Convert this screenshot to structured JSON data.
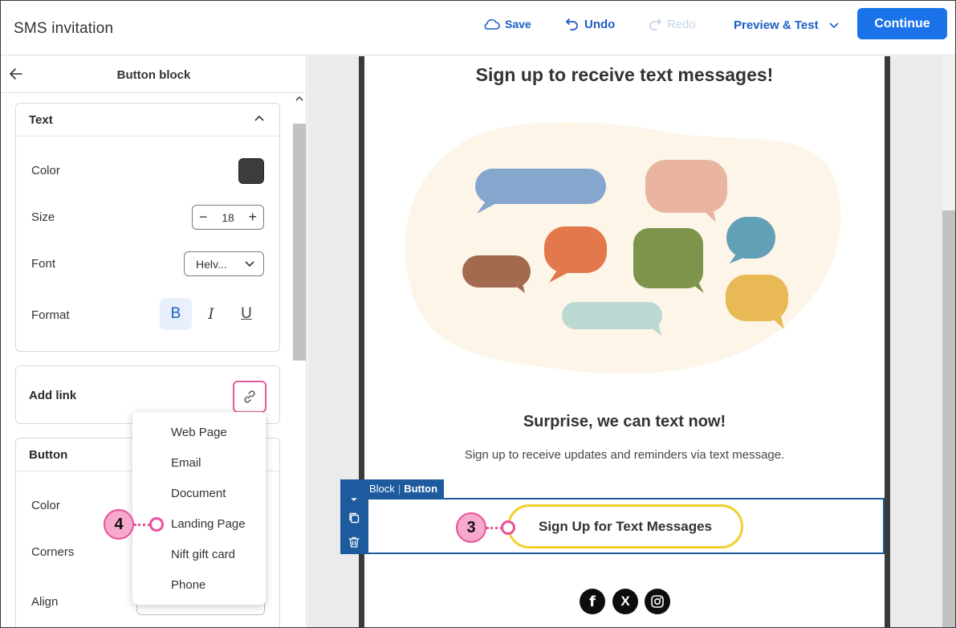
{
  "app": {
    "title": "SMS invitation"
  },
  "toolbar": {
    "save_label": "Save",
    "undo_label": "Undo",
    "redo_label": "Redo",
    "preview_label": "Preview & Test",
    "continue_label": "Continue"
  },
  "panel": {
    "title": "Button block",
    "text_section": {
      "title": "Text",
      "color_label": "Color",
      "color_value": "#3c3c3c",
      "size_label": "Size",
      "size_value": "18",
      "font_label": "Font",
      "font_value": "Helv...",
      "format_label": "Format",
      "format_bold": "B",
      "format_italic": "I",
      "format_underline": "U"
    },
    "link_section": {
      "title": "Add link"
    },
    "button_section": {
      "title": "Button",
      "color_label": "Color",
      "corners_label": "Corners",
      "align_label": "Align"
    },
    "link_menu": [
      "Web Page",
      "Email",
      "Document",
      "Landing Page",
      "Nift gift card",
      "Phone"
    ]
  },
  "callouts": {
    "four": "4",
    "three": "3"
  },
  "email": {
    "heading": "Sign up to receive text messages!",
    "subheading": "Surprise, we can text now!",
    "body": "Sign up to receive updates and reminders via text message.",
    "button_text": "Sign Up for Text Messages",
    "block_tag_prefix": "Block",
    "block_tag_type": "Button",
    "social": [
      "f",
      "X",
      "instagram"
    ]
  },
  "colors": {
    "accent": "#1a73e8",
    "highlight": "#e8519a",
    "cta_border": "#f2cf2a",
    "block_selection": "#1d5a9e"
  }
}
